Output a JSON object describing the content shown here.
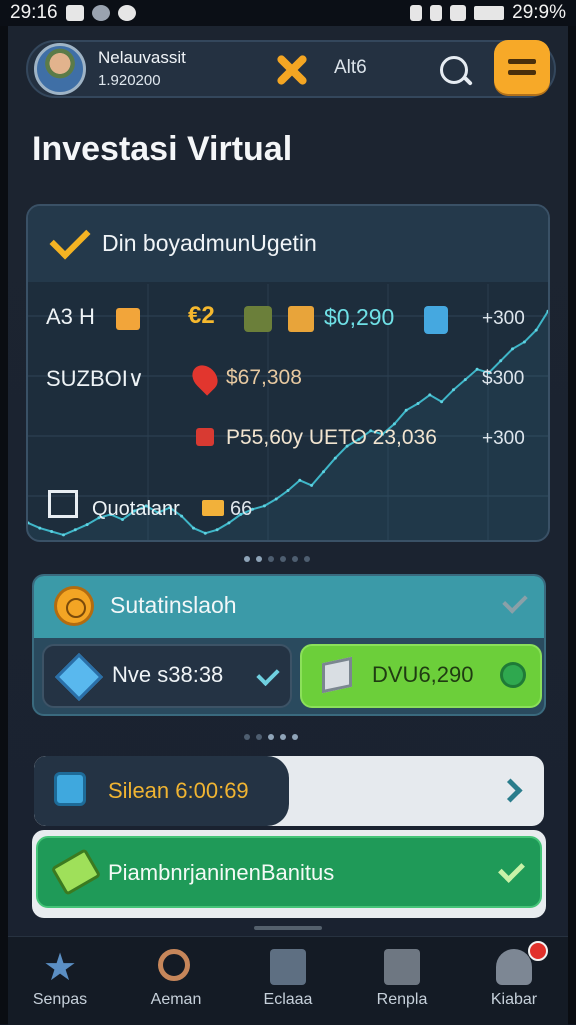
{
  "status_bar": {
    "time": "29:16",
    "battery": "29:9%"
  },
  "header": {
    "username": "Nelauvassit",
    "balance": "1.920200",
    "alt_label": "Alt6"
  },
  "page_title": "Investasi Virtual",
  "chart_card": {
    "title": "Din boyadmunUgetin",
    "rows": [
      {
        "label": "A3 H",
        "badge": "€2",
        "price": "$0,290",
        "axis": "+300"
      },
      {
        "label": "SUZBOI∨",
        "price": "$67,308",
        "axis": "$300"
      },
      {
        "label": "",
        "price": "P55,60y UETO 23,036",
        "axis": "+300"
      },
      {
        "label": "Quotalanr",
        "badge": "66"
      }
    ]
  },
  "chart_data": {
    "type": "line",
    "title": "Din boyadmunUgetin",
    "xlabel": "",
    "ylabel": "",
    "y_tick_labels": [
      "+300",
      "$300",
      "+300"
    ],
    "series": [
      {
        "values": [
          20,
          14,
          10,
          6,
          12,
          18,
          26,
          30,
          24,
          34,
          40,
          32,
          38,
          28,
          14,
          8,
          12,
          20,
          30,
          36,
          40,
          48,
          58,
          70,
          64,
          80,
          96,
          110,
          118,
          128,
          124,
          136,
          152,
          160,
          170,
          162,
          176,
          188,
          200,
          196,
          210,
          224,
          232,
          246,
          268
        ]
      }
    ],
    "ylim": [
      0,
      300
    ],
    "grid": true
  },
  "trade_card": {
    "title": "Sutatinslaoh",
    "left_pill": "Nve s38:38",
    "right_pill": "DVU6,290"
  },
  "timer": {
    "text": "Silean 6:00:69",
    "progress": 0.5
  },
  "confirm": {
    "label": "PiambnrjaninenBanitus"
  },
  "nav": {
    "items": [
      {
        "label": "Senpas",
        "icon": "star-icon"
      },
      {
        "label": "Aeman",
        "icon": "magnifier-icon"
      },
      {
        "label": "Eclaaa",
        "icon": "edit-icon"
      },
      {
        "label": "Renpla",
        "icon": "calendar-icon"
      },
      {
        "label": "Kiabar",
        "icon": "users-icon"
      }
    ]
  }
}
